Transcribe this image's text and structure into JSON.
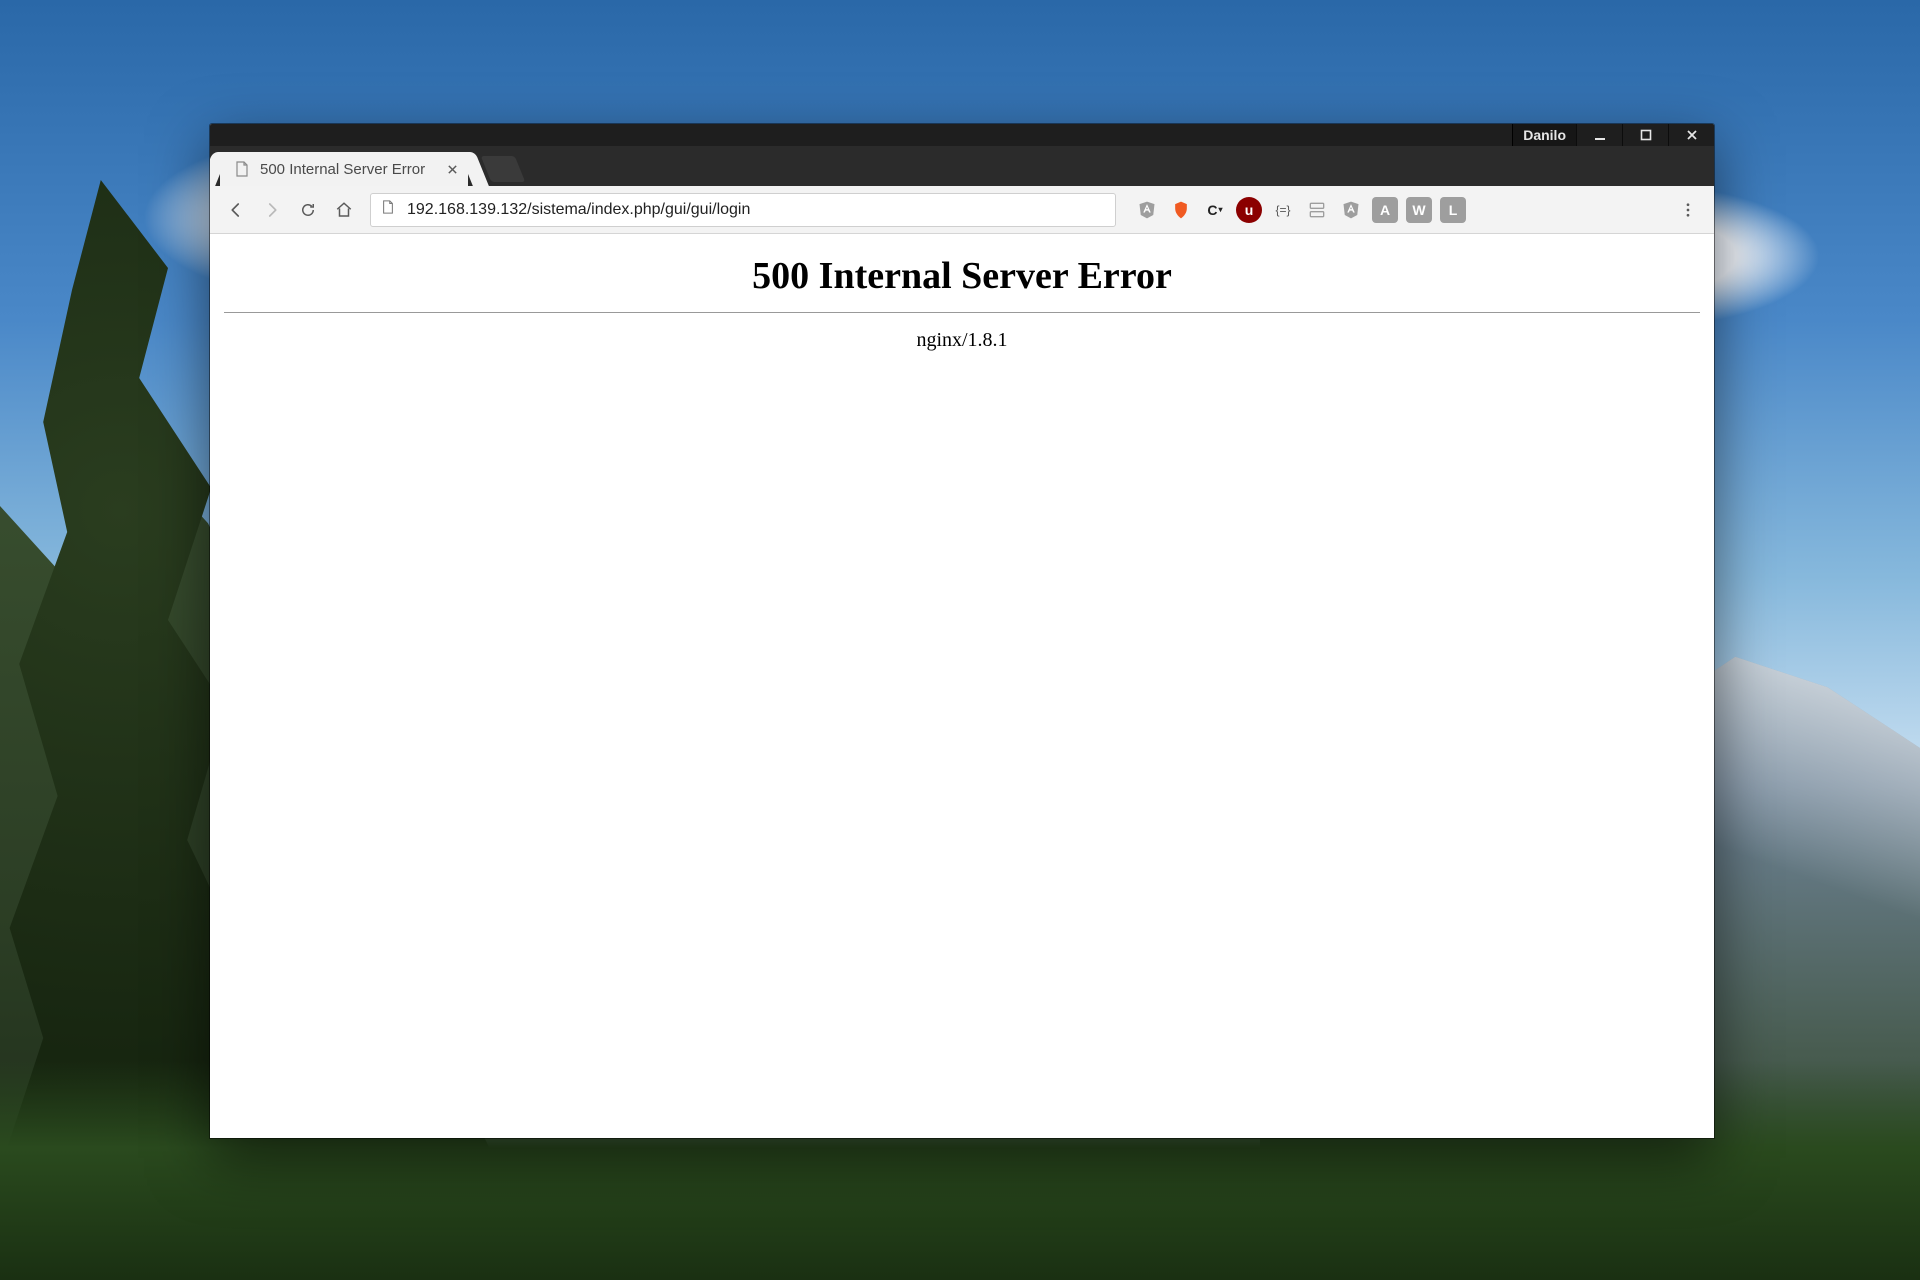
{
  "titlebar": {
    "profile_label": "Danilo"
  },
  "tab": {
    "title": "500 Internal Server Error"
  },
  "address_bar": {
    "url": "192.168.139.132/sistema/index.php/gui/gui/login"
  },
  "extensions": {
    "angular": "A",
    "brave": "🛡",
    "c_ext": "C",
    "ublock": "u",
    "brackets": "{=}",
    "a_ext": "A",
    "w_ext": "W",
    "l_ext": "L"
  },
  "page": {
    "heading": "500 Internal Server Error",
    "server_line": "nginx/1.8.1"
  }
}
